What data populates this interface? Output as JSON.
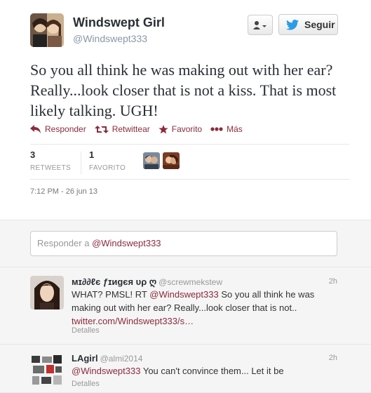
{
  "tweet": {
    "fullname": "Windswept Girl",
    "username": "@Windswept333",
    "text": "So you all think he was making out with her ear? Really...look closer that is not a kiss. That is most likely talking. UGH!",
    "follow_label": "Seguir",
    "actions": {
      "reply": "Responder",
      "retweet": "Retwittear",
      "favorite": "Favorito",
      "more": "Más"
    },
    "stats": {
      "retweets_count": "3",
      "retweets_label": "RETWEETS",
      "favorites_count": "1",
      "favorites_label": "FAVORITO"
    },
    "timestamp": "7:12 PM - 26 jun 13"
  },
  "reply_box": {
    "prefix": "Responder a ",
    "mention": "@Windswept333"
  },
  "replies": [
    {
      "name": "ᴍɪ∂∂ℓє ƒɪиgєя υρ ღ",
      "handle": "@screwmekstew",
      "time": "2h",
      "text_prefix": "WHAT? PMSL! RT ",
      "text_mention": "@Windswept333",
      "text_body": " So you all think he was making out with her ear? Really...look closer that is not..",
      "text_link": "twitter.com/Windswept333/s…",
      "detail": "Detalles"
    },
    {
      "name": "LAgirl",
      "handle": "@almi2014",
      "time": "2h",
      "text_mention": "@Windswept333",
      "text_body": " You can't convince them... Let it be",
      "detail": "Detalles"
    }
  ],
  "colors": {
    "accent": "#8b2b3c",
    "twitter_blue": "#2b9ce6",
    "muted": "#999999",
    "reply_bg": "#f5f5f5"
  }
}
